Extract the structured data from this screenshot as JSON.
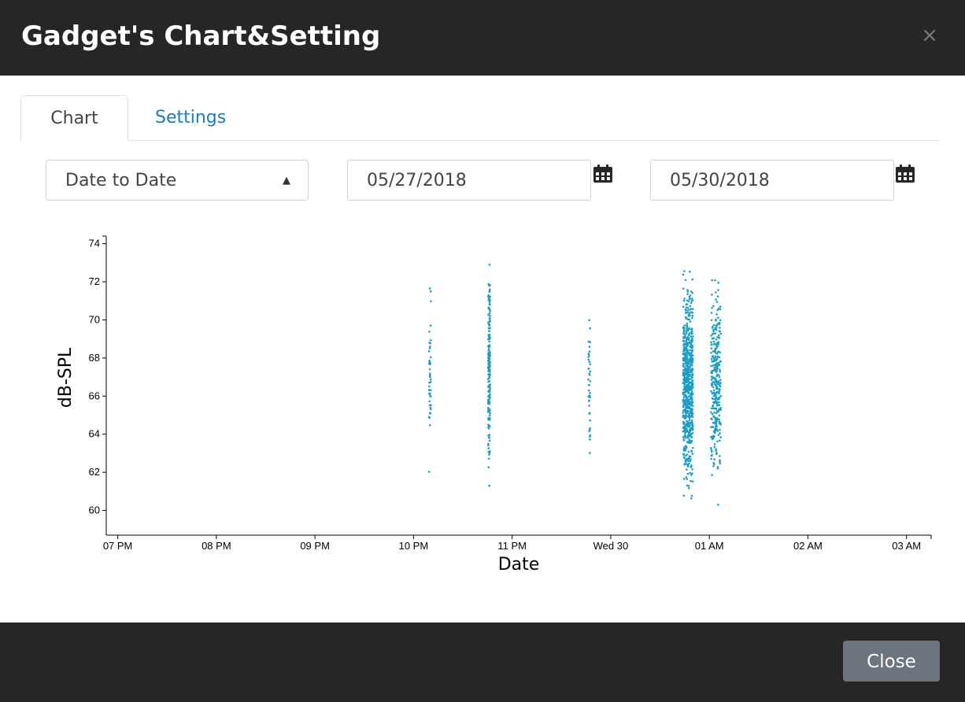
{
  "dialog": {
    "title": "Gadget's Chart&Setting",
    "close_icon": "×"
  },
  "tabs": [
    {
      "label": "Chart",
      "active": true
    },
    {
      "label": "Settings",
      "active": false
    }
  ],
  "filters": {
    "range_mode": "Date to Date",
    "start_date": "05/27/2018",
    "end_date": "05/30/2018",
    "calendar_icon": "calendar-icon"
  },
  "footer": {
    "close_label": "Close"
  },
  "colors": {
    "header_bg": "#262626",
    "point_color": "#1a9ec6",
    "tab_active_text": "#444444",
    "tab_link": "#1a7ac8",
    "close_button_bg": "#6c757d"
  },
  "chart_data": {
    "type": "scatter",
    "xlabel": "Date",
    "ylabel": "dB-SPL",
    "ylim": [
      58.7,
      74.4
    ],
    "x_domain": [
      "2018-05-29T18:53",
      "2018-05-30T03:15"
    ],
    "y_ticks": [
      60,
      62,
      64,
      66,
      68,
      70,
      72,
      74
    ],
    "x_ticks": [
      {
        "t": "2018-05-29T19:00",
        "label": "07 PM"
      },
      {
        "t": "2018-05-29T20:00",
        "label": "08 PM"
      },
      {
        "t": "2018-05-29T21:00",
        "label": "09 PM"
      },
      {
        "t": "2018-05-29T22:00",
        "label": "10 PM"
      },
      {
        "t": "2018-05-29T23:00",
        "label": "11 PM"
      },
      {
        "t": "2018-05-30T00:00",
        "label": "Wed 30"
      },
      {
        "t": "2018-05-30T01:00",
        "label": "01 AM"
      },
      {
        "t": "2018-05-30T02:00",
        "label": "02 AM"
      },
      {
        "t": "2018-05-30T03:00",
        "label": "03 AM"
      }
    ],
    "grid": false,
    "legend": "none",
    "clusters": [
      {
        "t": "2018-05-29T22:10",
        "count": 45,
        "y_min": 61.0,
        "y_max": 72.7
      },
      {
        "t": "2018-05-29T22:46",
        "count": 180,
        "y_min": 60.4,
        "y_max": 74.3
      },
      {
        "t": "2018-05-29T23:47",
        "count": 40,
        "y_min": 60.7,
        "y_max": 72.2
      },
      {
        "t": "2018-05-30T00:47",
        "count": 700,
        "y_min": 58.8,
        "y_max": 74.2
      },
      {
        "t": "2018-05-30T01:04",
        "count": 320,
        "y_min": 59.2,
        "y_max": 74.1
      }
    ]
  }
}
